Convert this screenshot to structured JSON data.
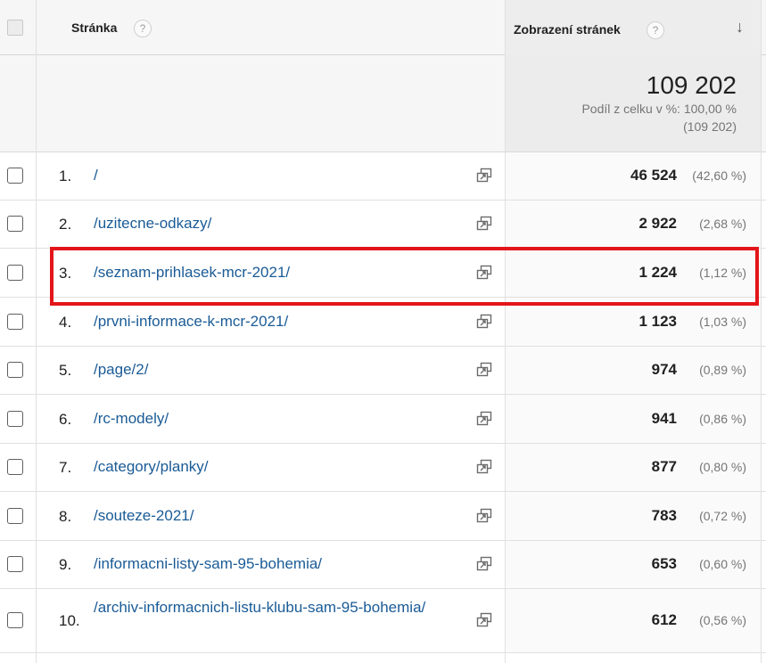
{
  "header": {
    "page_label": "Stránka",
    "metric_label": "Zobrazení stránek",
    "help_glyph": "?",
    "sort_glyph": "↓"
  },
  "totals": {
    "value": "109 202",
    "share": "Podíl z celku v %: 100,00 %",
    "absolute": "(109 202)"
  },
  "rows": [
    {
      "idx": "1.",
      "path": "/",
      "value": "46 524",
      "pct": "(42,60 %)"
    },
    {
      "idx": "2.",
      "path": "/uzitecne-odkazy/",
      "value": "2 922",
      "pct": "(2,68 %)"
    },
    {
      "idx": "3.",
      "path": "/seznam-prihlasek-mcr-2021/",
      "value": "1 224",
      "pct": "(1,12 %)"
    },
    {
      "idx": "4.",
      "path": "/prvni-informace-k-mcr-2021/",
      "value": "1 123",
      "pct": "(1,03 %)"
    },
    {
      "idx": "5.",
      "path": "/page/2/",
      "value": "974",
      "pct": "(0,89 %)"
    },
    {
      "idx": "6.",
      "path": "/rc-modely/",
      "value": "941",
      "pct": "(0,86 %)"
    },
    {
      "idx": "7.",
      "path": "/category/planky/",
      "value": "877",
      "pct": "(0,80 %)"
    },
    {
      "idx": "8.",
      "path": "/souteze-2021/",
      "value": "783",
      "pct": "(0,72 %)"
    },
    {
      "idx": "9.",
      "path": "/informacni-listy-sam-95-bohemia/",
      "value": "653",
      "pct": "(0,60 %)"
    },
    {
      "idx": "10.",
      "path": "/archiv-informacnich-listu-klubu-sam-95-bohemia/",
      "value": "612",
      "pct": "(0,56 %)"
    }
  ],
  "colors": {
    "link": "#1a5b96",
    "highlight": "#e3151a"
  },
  "icons": {
    "help": "help-icon",
    "sort": "sort-arrow-down-icon",
    "open_page": "open-in-new-window-icon"
  }
}
